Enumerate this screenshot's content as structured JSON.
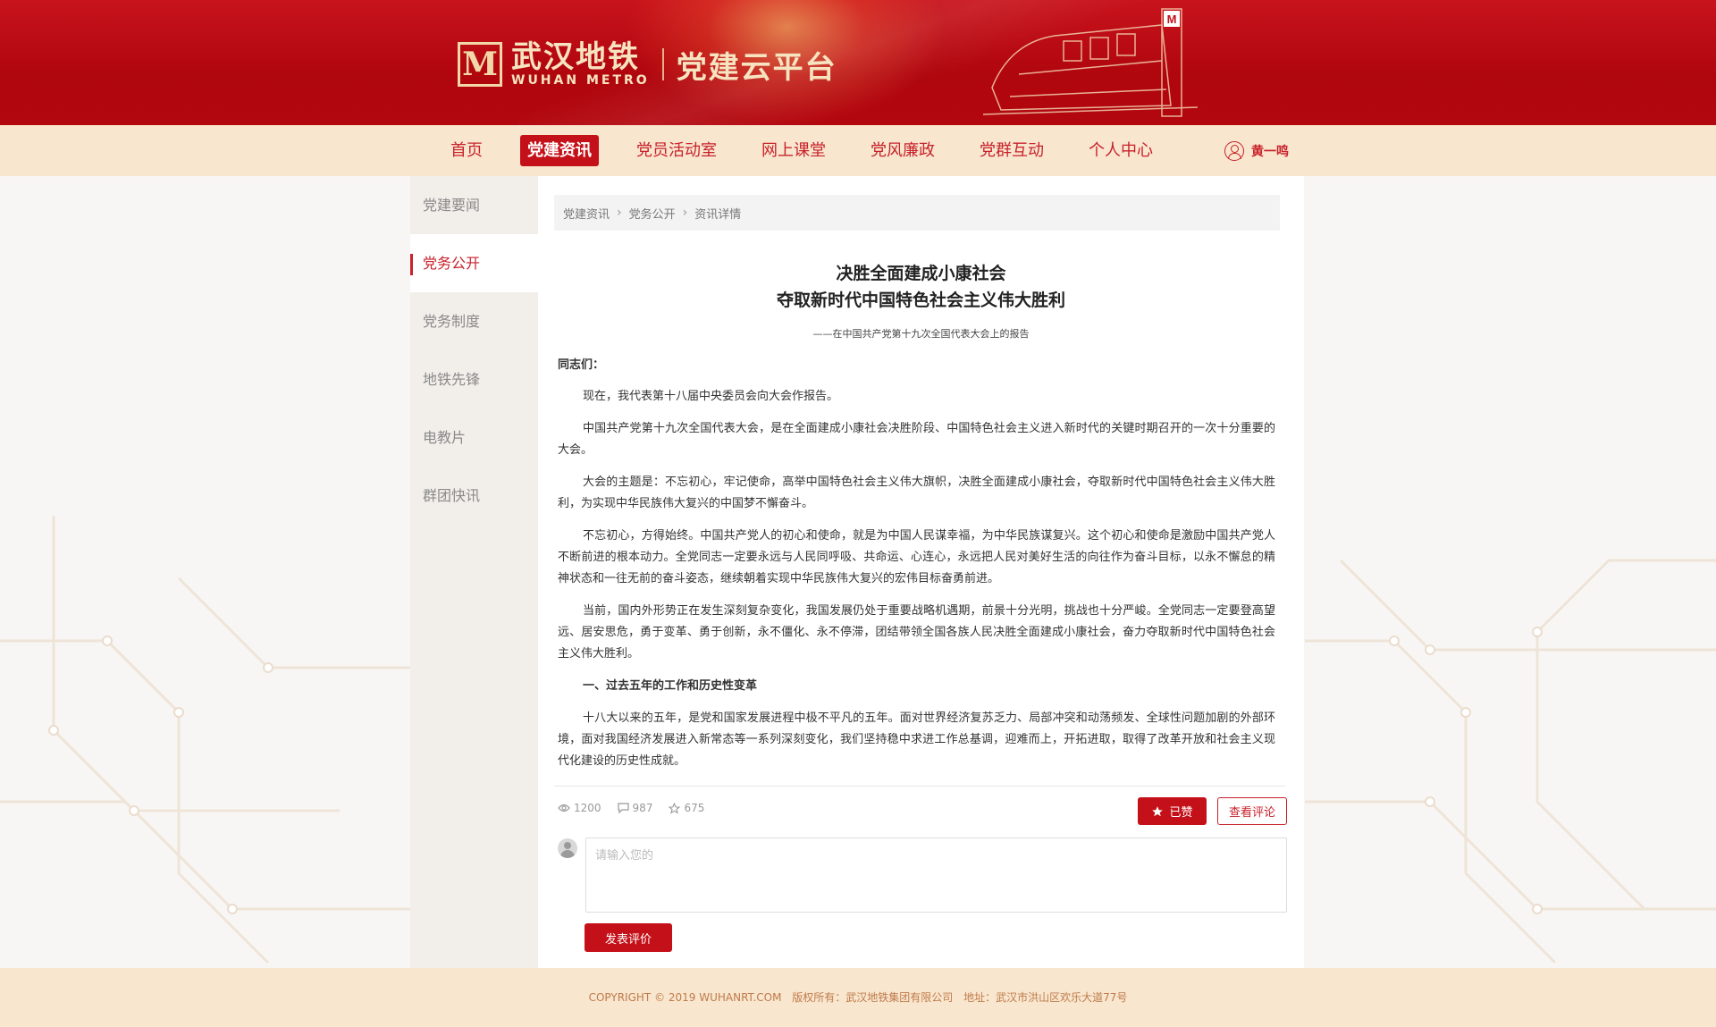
{
  "header": {
    "logo_mark": "M",
    "brand_cn": "武汉地铁",
    "brand_en": "WUHAN METRO",
    "platform": "党建云平台",
    "colors": {
      "primary": "#c41018",
      "nav_bg": "#f8e6cf",
      "accent_gold": "#f2d8a8"
    }
  },
  "nav": {
    "items": [
      {
        "label": "首页",
        "active": false
      },
      {
        "label": "党建资讯",
        "active": true
      },
      {
        "label": "党员活动室",
        "active": false
      },
      {
        "label": "网上课堂",
        "active": false
      },
      {
        "label": "党风廉政",
        "active": false
      },
      {
        "label": "党群互动",
        "active": false
      },
      {
        "label": "个人中心",
        "active": false
      }
    ],
    "user_name": "黄一鸣",
    "user_icon": "user-icon"
  },
  "sidebar": {
    "items": [
      {
        "label": "党建要闻",
        "active": false
      },
      {
        "label": "党务公开",
        "active": true
      },
      {
        "label": "党务制度",
        "active": false
      },
      {
        "label": "地铁先锋",
        "active": false
      },
      {
        "label": "电教片",
        "active": false
      },
      {
        "label": "群团快讯",
        "active": false
      }
    ]
  },
  "breadcrumb": [
    "党建资讯",
    "党务公开",
    "资讯详情"
  ],
  "article": {
    "title_line1": "决胜全面建成小康社会",
    "title_line2": "夺取新时代中国特色社会主义伟大胜利",
    "subtitle": "——在中国共产党第十九次全国代表大会上的报告",
    "greeting": "同志们：",
    "paragraphs": [
      "现在，我代表第十八届中央委员会向大会作报告。",
      "中国共产党第十九次全国代表大会，是在全面建成小康社会决胜阶段、中国特色社会主义进入新时代的关键时期召开的一次十分重要的大会。",
      "大会的主题是：不忘初心，牢记使命，高举中国特色社会主义伟大旗帜，决胜全面建成小康社会，夺取新时代中国特色社会主义伟大胜利，为实现中华民族伟大复兴的中国梦不懈奋斗。",
      "不忘初心，方得始终。中国共产党人的初心和使命，就是为中国人民谋幸福，为中华民族谋复兴。这个初心和使命是激励中国共产党人不断前进的根本动力。全党同志一定要永远与人民同呼吸、共命运、心连心，永远把人民对美好生活的向往作为奋斗目标，以永不懈怠的精神状态和一往无前的奋斗姿态，继续朝着实现中华民族伟大复兴的宏伟目标奋勇前进。",
      "当前，国内外形势正在发生深刻复杂变化，我国发展仍处于重要战略机遇期，前景十分光明，挑战也十分严峻。全党同志一定要登高望远、居安思危，勇于变革、勇于创新，永不僵化、永不停滞，团结带领全国各族人民决胜全面建成小康社会，奋力夺取新时代中国特色社会主义伟大胜利。"
    ],
    "section_heading": "一、过去五年的工作和历史性变革",
    "section_paragraph": "十八大以来的五年，是党和国家发展进程中极不平凡的五年。面对世界经济复苏乏力、局部冲突和动荡频发、全球性问题加剧的外部环境，面对我国经济发展进入新常态等一系列深刻变化，我们坚持稳中求进工作总基调，迎难而上，开拓进取，取得了改革开放和社会主义现代化建设的历史性成就。"
  },
  "stats": {
    "views": "1200",
    "comments": "987",
    "stars": "675"
  },
  "actions": {
    "liked_label": "已赞",
    "view_comments_label": "查看评论",
    "comment_placeholder": "请输入您的",
    "submit_label": "发表评价"
  },
  "footer": {
    "copyright": "COPYRIGHT © 2019 WUHANRT.COM",
    "owner": "版权所有：武汉地铁集团有限公司",
    "address": "地址：武汉市洪山区欢乐大道77号"
  }
}
